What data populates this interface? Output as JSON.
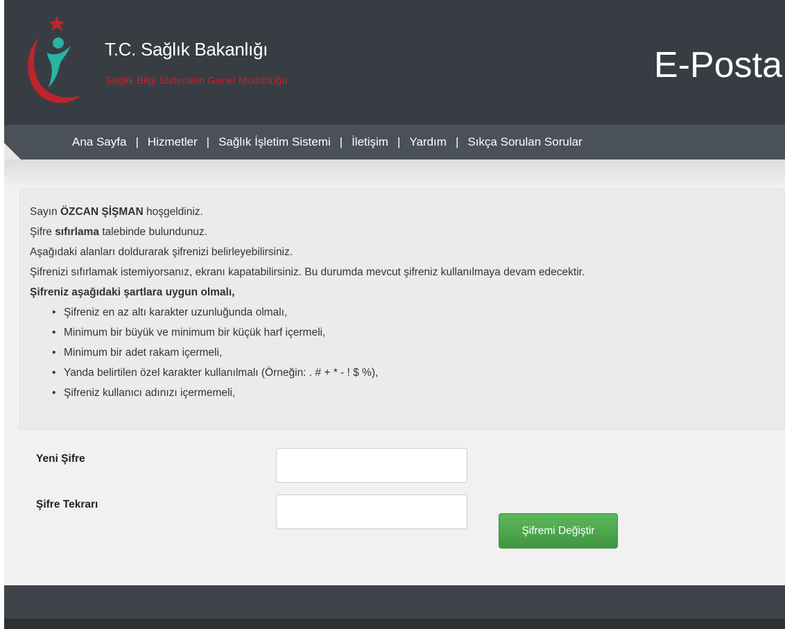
{
  "header": {
    "org_name": "T.C. Sağlık Bakanlığı",
    "org_sub": "Sağlık Bilgi Sistemleri Genel Müdürlüğü",
    "app_title": "E-Posta",
    "logo_icon": "ministry-logo-icon"
  },
  "nav": {
    "separator": "|",
    "items": [
      {
        "label": "Ana Sayfa"
      },
      {
        "label": "Hizmetler"
      },
      {
        "label": "Sağlık İşletim Sistemi"
      },
      {
        "label": "İletişim"
      },
      {
        "label": "Yardım"
      },
      {
        "label": "Sıkça Sorulan Sorular"
      }
    ]
  },
  "info": {
    "line1_pre": "Sayın ",
    "line1_name": "ÖZCAN ŞİŞMAN",
    "line1_post": " hoşgeldiniz.",
    "line2_pre": "Şifre ",
    "line2_bold": "sıfırlama",
    "line2_post": " talebinde bulundunuz.",
    "line3": "Aşağıdaki alanları doldurarak şifrenizi belirleyebilirsiniz.",
    "line4": "Şifrenizi sıfırlamak istemiyorsanız, ekranı kapatabilirsiniz. Bu durumda mevcut şifreniz kullanılmaya devam edecektir.",
    "rules_title": "Şifreniz aşağıdaki şartlara uygun olmalı,",
    "rules": [
      "Şifreniz en az altı karakter uzunluğunda olmalı,",
      "Minimum bir büyük ve minimum bir küçük harf içermeli,",
      "Minimum bir adet rakam içermeli,",
      "Yanda belirtilen özel karakter kullanılmalı (Örneğin: . # + * - ! $ %),",
      "Şifreniz kullanıcı adınızı içermemeli,"
    ]
  },
  "form": {
    "new_password_label": "Yeni Şifre",
    "new_password_value": "",
    "repeat_password_label": "Şifre Tekrarı",
    "repeat_password_value": "",
    "submit_label": "Şifremi Değiştir"
  },
  "colors": {
    "header_bg": "#383d44",
    "nav_bg": "#4b5159",
    "brand_red": "#c0242b",
    "logo_teal": "#2ab3a6",
    "button_green": "#4cae4c"
  }
}
